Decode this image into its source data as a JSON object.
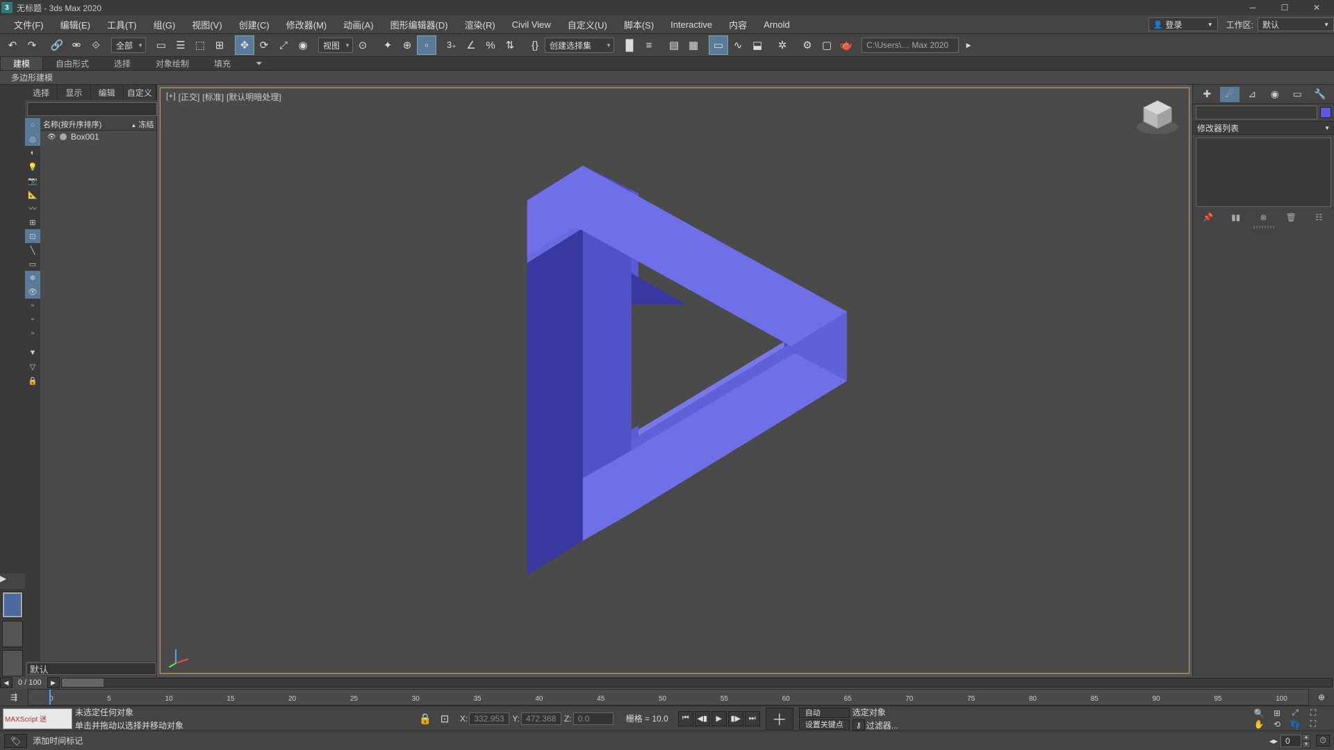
{
  "titlebar": {
    "app_icon_text": "3",
    "title": "无标题 - 3ds Max 2020"
  },
  "menubar": {
    "items": [
      "文件(F)",
      "编辑(E)",
      "工具(T)",
      "组(G)",
      "视图(V)",
      "创建(C)",
      "修改器(M)",
      "动画(A)",
      "图形编辑器(D)",
      "渲染(R)",
      "Civil View",
      "自定义(U)",
      "脚本(S)",
      "Interactive",
      "内容",
      "Arnold"
    ],
    "signin": "登录",
    "workspace_label": "工作区:",
    "workspace_value": "默认"
  },
  "toolbar": {
    "all_drop": "全部",
    "view_drop": "视图",
    "selset_drop": "创建选择集",
    "path_text": "C:\\Users\\… Max 2020"
  },
  "ribbon": {
    "tabs": [
      "建模",
      "自由形式",
      "选择",
      "对象绘制",
      "填充"
    ],
    "subtab": "多边形建模"
  },
  "scene_panel": {
    "tabs": [
      "选择",
      "显示",
      "编辑",
      "自定义"
    ],
    "header_name": "名称(按升序排序)",
    "header_freeze": "冻结",
    "items": [
      {
        "name": "Box001"
      }
    ],
    "layer_default": "默认"
  },
  "viewport": {
    "labels": [
      "[+]",
      "[正交]",
      "[标准]",
      "[默认明暗处理]"
    ]
  },
  "cmd_panel": {
    "modlist_label": "修改器列表"
  },
  "timeline": {
    "indicator": "0  /  100",
    "ticks": [
      "0",
      "5",
      "10",
      "15",
      "20",
      "25",
      "30",
      "35",
      "40",
      "45",
      "50",
      "55",
      "60",
      "65",
      "70",
      "75",
      "80",
      "85",
      "90",
      "95",
      "100"
    ]
  },
  "status": {
    "maxscript": "MAXScript 迷",
    "prompt_line1": "未选定任何对象",
    "prompt_line2": "单击并拖动以选择并移动对象",
    "coords": {
      "x_label": "X:",
      "x": "332.953",
      "y_label": "Y:",
      "y": "472.368",
      "z_label": "Z:",
      "z": "0.0"
    },
    "grid": "栅格 = 10.0",
    "addtime": "添加时间标记",
    "auto": "自动",
    "selobj": "选定对象",
    "setkey": "设置关键点",
    "filter": "过滤器..."
  }
}
